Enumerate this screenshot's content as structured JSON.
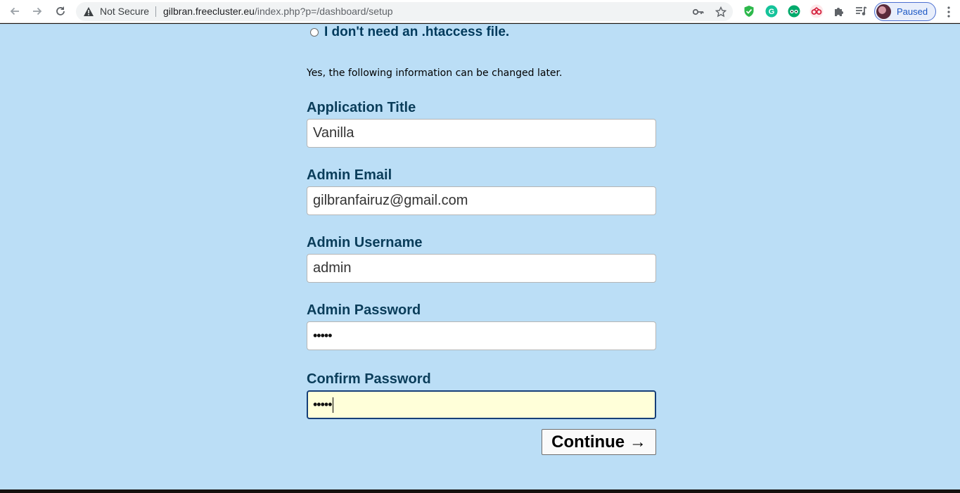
{
  "browser": {
    "security_label": "Not Secure",
    "url_host": "gilbran.freecluster.eu",
    "url_path": "/index.php?p=/dashboard/setup",
    "profile_label": "Paused",
    "icons": [
      "back-icon",
      "forward-icon",
      "reload-icon",
      "warning-icon",
      "key-icon",
      "star-icon",
      "shield-extension-icon",
      "grammarly-icon",
      "tripadvisor-icon",
      "ext-red-icon",
      "puzzle-icon",
      "reading-list-icon",
      "menu-icon"
    ]
  },
  "page": {
    "htaccess_option": "I don't need an .htaccess file.",
    "note": "Yes, the following information can be changed later.",
    "fields": [
      {
        "label": "Application Title",
        "value": "Vanilla"
      },
      {
        "label": "Admin Email",
        "value": "gilbranfairuz@gmail.com"
      },
      {
        "label": "Admin Username",
        "value": "admin"
      },
      {
        "label": "Admin Password",
        "value": "•••••"
      },
      {
        "label": "Confirm Password",
        "value": "•••••"
      }
    ],
    "continue_label": "Continue →"
  },
  "colors": {
    "page_bg": "#bbdef6",
    "label_text": "#0a3d5a",
    "focused_input_bg": "#ffffd9",
    "focused_input_border": "#163f78"
  }
}
